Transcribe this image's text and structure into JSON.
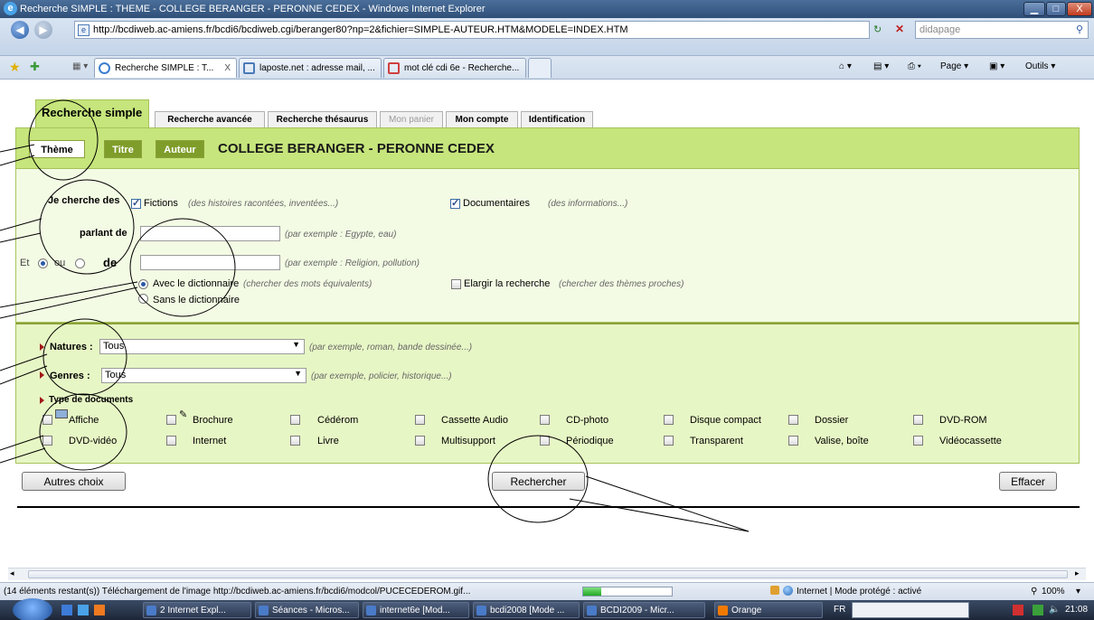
{
  "window": {
    "title": "Recherche SIMPLE : THEME - COLLEGE BERANGER - PERONNE CEDEX - Windows Internet Explorer",
    "ie_icon": "ie-logo-icon",
    "minimize": "▁",
    "maximize": "□",
    "close": "X"
  },
  "address": {
    "url": "http://bcdiweb.ac-amiens.fr/bcdi6/bcdiweb.cgi/beranger80?np=2&fichier=SIMPLE-AUTEUR.HTM&MODELE=INDEX.HTM",
    "search_text": "didapage",
    "back": "◀",
    "forward": "▶"
  },
  "browser_tabs": [
    {
      "label": "Recherche SIMPLE : T...",
      "close": "X"
    },
    {
      "label": "laposte.net : adresse mail, ..."
    },
    {
      "label": "mot clé cdi 6e - Recherche..."
    }
  ],
  "commands": {
    "page": "Page ▾",
    "tools": "Outils ▾"
  },
  "page": {
    "tabs": {
      "simple": "Recherche simple",
      "advanced": "Recherche avancée",
      "thesaurus": "Recherche thésaurus",
      "basket": "Mon panier",
      "account": "Mon compte",
      "login": "Identification"
    },
    "subtabs": {
      "theme": "Thème",
      "title": "Titre",
      "author": "Auteur"
    },
    "school": "COLLEGE BERANGER - PERONNE CEDEX",
    "search": {
      "je_cherche": "Je cherche des",
      "fictions": "Fictions",
      "fictions_hint": "(des histoires racontées, inventées...)",
      "documentaires": "Documentaires",
      "documentaires_hint": "(des informations...)",
      "parlant_de": "parlant de",
      "example1": "(par exemple : Egypte, eau)",
      "et": "Et",
      "ou": "ou",
      "de": "de",
      "example2": "(par exemple : Religion, pollution)",
      "avec_dico": "Avec le dictionnaire",
      "avec_dico_hint": "(chercher des mots équivalents)",
      "sans_dico": "Sans le dictionnaire",
      "elargir": "Elargir la recherche",
      "elargir_hint": "(chercher des thèmes proches)"
    },
    "filters": {
      "natures_label": "Natures :",
      "natures_value": "Tous",
      "natures_hint": "(par exemple, roman, bande dessinée...)",
      "genres_label": "Genres :",
      "genres_value": "Tous",
      "genres_hint": "(par exemple, policier, historique...)",
      "types_label": "Type de documents"
    },
    "doc_types": [
      "Affiche",
      "Brochure",
      "Cédérom",
      "Cassette Audio",
      "CD-photo",
      "Disque compact",
      "Dossier",
      "DVD-ROM",
      "DVD-vidéo",
      "Internet",
      "Livre",
      "Multisupport",
      "Périodique",
      "Transparent",
      "Valise, boîte",
      "Vidéocassette"
    ],
    "buttons": {
      "other": "Autres choix",
      "search": "Rechercher",
      "clear": "Effacer"
    }
  },
  "status": {
    "text": "(14 éléments restant(s)) Téléchargement de l'image http://bcdiweb.ac-amiens.fr/bcdi6/modcol/PUCECEDEROM.gif...",
    "zone": "Internet | Mode protégé : activé",
    "zoom": "100%",
    "progress": 0.2
  },
  "taskbar": {
    "items": [
      "2 Internet Expl...",
      "Séances - Micros...",
      "internet6e [Mod...",
      "bcdi2008 [Mode ...",
      "BCDI2009 - Micr...",
      "Orange"
    ],
    "lang": "FR",
    "clock": "21:08"
  }
}
